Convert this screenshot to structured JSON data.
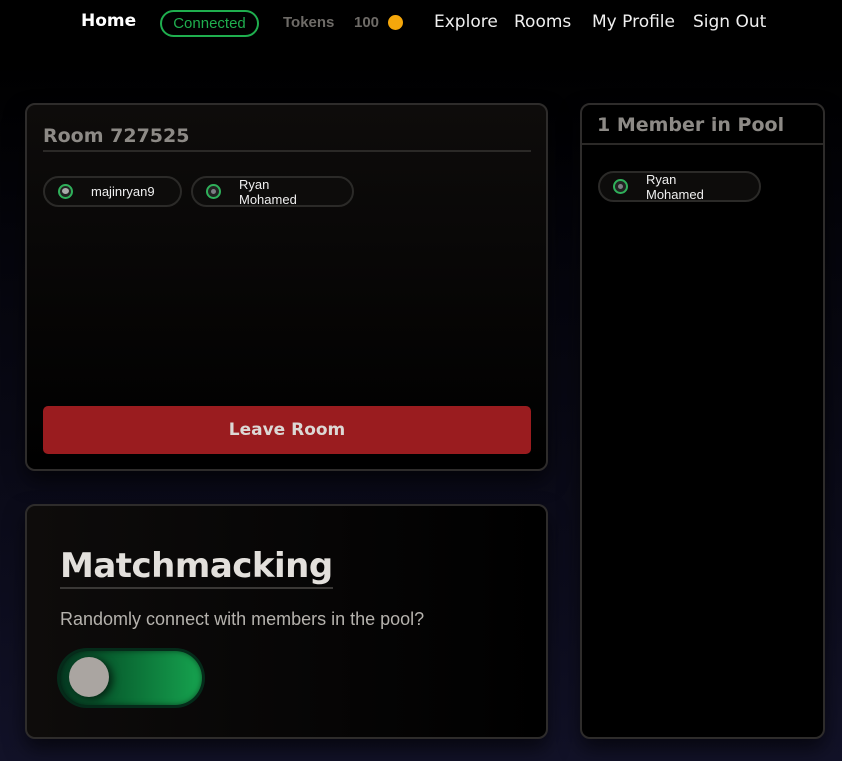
{
  "nav": {
    "home": "Home",
    "status": "Connected",
    "tokens_label": "Tokens",
    "tokens_value": "100",
    "links": [
      "Explore",
      "Rooms",
      "My Profile",
      "Sign Out"
    ]
  },
  "room": {
    "title": "Room 727525",
    "members": [
      {
        "name": "majinryan9",
        "avatar": "avatar-icon"
      },
      {
        "name": "Ryan Mohamed",
        "avatar": "avatar-icon"
      }
    ],
    "leave_label": "Leave Room"
  },
  "matchmaking": {
    "title": "Matchmacking",
    "description": "Randomly connect with members in the pool?",
    "toggle_on": false
  },
  "pool": {
    "title": "1 Member in Pool",
    "members": [
      {
        "name": "Ryan Mohamed",
        "avatar": "avatar-icon"
      }
    ]
  },
  "colors": {
    "connected": "#1fae4e",
    "coin": "#f5a70b",
    "leave": "#9a1c1f",
    "toggle_green": "#16a34f"
  }
}
